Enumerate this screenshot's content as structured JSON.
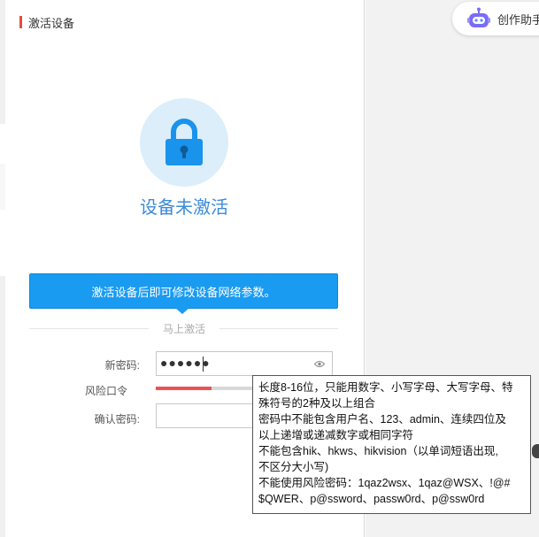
{
  "section": {
    "title": "激活设备",
    "accent_color": "#e74c3c"
  },
  "status": {
    "text": "设备未激活",
    "icon": "lock-icon",
    "color": "#3b8bd9"
  },
  "info_banner": {
    "text": "激活设备后即可修改设备网络参数。",
    "color": "#1a9bf2"
  },
  "activate_link": {
    "label": "马上激活"
  },
  "form": {
    "new_password": {
      "label": "新密码:",
      "value": "●●●●●●",
      "toggle_icon": "eye-icon"
    },
    "risk": {
      "label": "风险口令",
      "strength": 0.55,
      "color": "#e85454"
    },
    "confirm_password": {
      "label": "确认密码:",
      "value": ""
    }
  },
  "tooltip": {
    "lines": [
      "长度8-16位，只能用数字、小写字母、大写字母、特",
      "殊符号的2种及以上组合",
      "密码中不能包含用户名、123、admin、连续四位及",
      "以上递增或递减数字或相同字符",
      "不能包含hik、hkws、hikvision（以单词短语出现,",
      "不区分大小写)",
      "不能使用风险密码：1qaz2wsx、1qaz@WSX、!@#",
      "$QWER、p@ssword、passw0rd、p@ssw0rd"
    ]
  },
  "assistant": {
    "label": "创作助手",
    "icon": "robot-icon"
  }
}
